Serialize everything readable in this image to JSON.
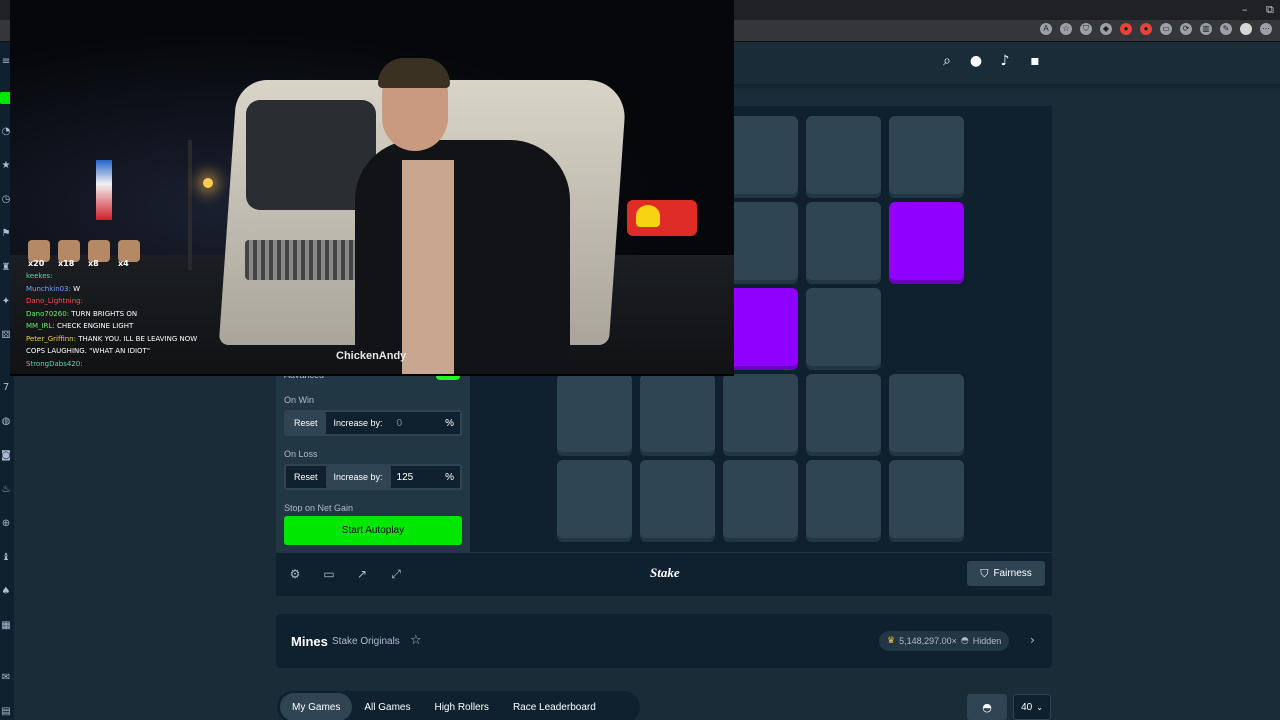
{
  "browser": {
    "win_minimize": "–",
    "win_restore": "⧉",
    "extensions": [
      "A",
      "☆",
      "⛉",
      "◆",
      "●",
      "●",
      "▭",
      "⟳",
      "▥",
      "✎",
      "⋯"
    ]
  },
  "header": {
    "search_icon": "search-icon",
    "user_icon": "user-icon",
    "bell_icon": "bell-icon",
    "chat_icon": "chat-icon"
  },
  "controls": {
    "advanced_label": "Advanced",
    "on_win_label": "On Win",
    "on_win_reset": "Reset",
    "on_win_increase": "Increase by:",
    "on_win_value": "0",
    "on_win_unit": "%",
    "on_loss_label": "On Loss",
    "on_loss_reset": "Reset",
    "on_loss_increase": "Increase by:",
    "on_loss_value": "125",
    "on_loss_unit": "%",
    "stop_on_net_gain_label": "Stop on Net Gain",
    "start_autoplay": "Start Autoplay"
  },
  "board": {
    "tiles": [
      "hidden",
      "hidden",
      "hidden",
      "hidden",
      "hidden",
      "gem",
      "gem",
      "gem",
      "hidden",
      "hidden",
      "hidden",
      "hidden",
      "hidden",
      "hidden",
      "hidden",
      "hidden",
      "hidden",
      "hidden",
      "hidden"
    ],
    "gem_color": "#9000ff",
    "tile_color": "#2f4553"
  },
  "game_footer": {
    "logo": "Stake",
    "fairness": "Fairness"
  },
  "info": {
    "title": "Mines",
    "subtitle": "Stake Originals",
    "max_multiplier": "5,148,297.00×",
    "hidden_label": "Hidden"
  },
  "tabs": {
    "my_games": "My Games",
    "all_games": "All Games",
    "high_rollers": "High Rollers",
    "race_leaderboard": "Race Leaderboard"
  },
  "table_controls": {
    "count": "40"
  },
  "webcam": {
    "watermark": "ChickenAndy",
    "emotes": [
      "x20",
      "x18",
      "x8",
      "x4"
    ],
    "chat": [
      {
        "user": "keekes:",
        "msg": "",
        "cls": "u-teal"
      },
      {
        "user": "Munchkin03:",
        "msg": "W",
        "cls": "u-blue"
      },
      {
        "user": "Dano_Lightning:",
        "msg": "",
        "cls": "u-red"
      },
      {
        "user": "Dano70260:",
        "msg": "TURN BRIGHTS ON",
        "cls": "u-green"
      },
      {
        "user": "MM_IRL:",
        "msg": "CHECK ENGINE LIGHT",
        "cls": "u-green"
      },
      {
        "user": "Peter_Griffinn:",
        "msg": "THANK YOU. ILL BE LEAVING NOW",
        "cls": "u-yellow"
      },
      {
        "user": "",
        "msg": "COPS LAUGHING. \"WHAT AN IDIOT\"",
        "cls": "u-teal"
      },
      {
        "user": "StrongDabs420:",
        "msg": "",
        "cls": "u-teal"
      }
    ]
  },
  "colors": {
    "bg": "#1a2c38",
    "panel": "#213743",
    "accent_green": "#00e701",
    "gem_purple": "#9000ff"
  }
}
